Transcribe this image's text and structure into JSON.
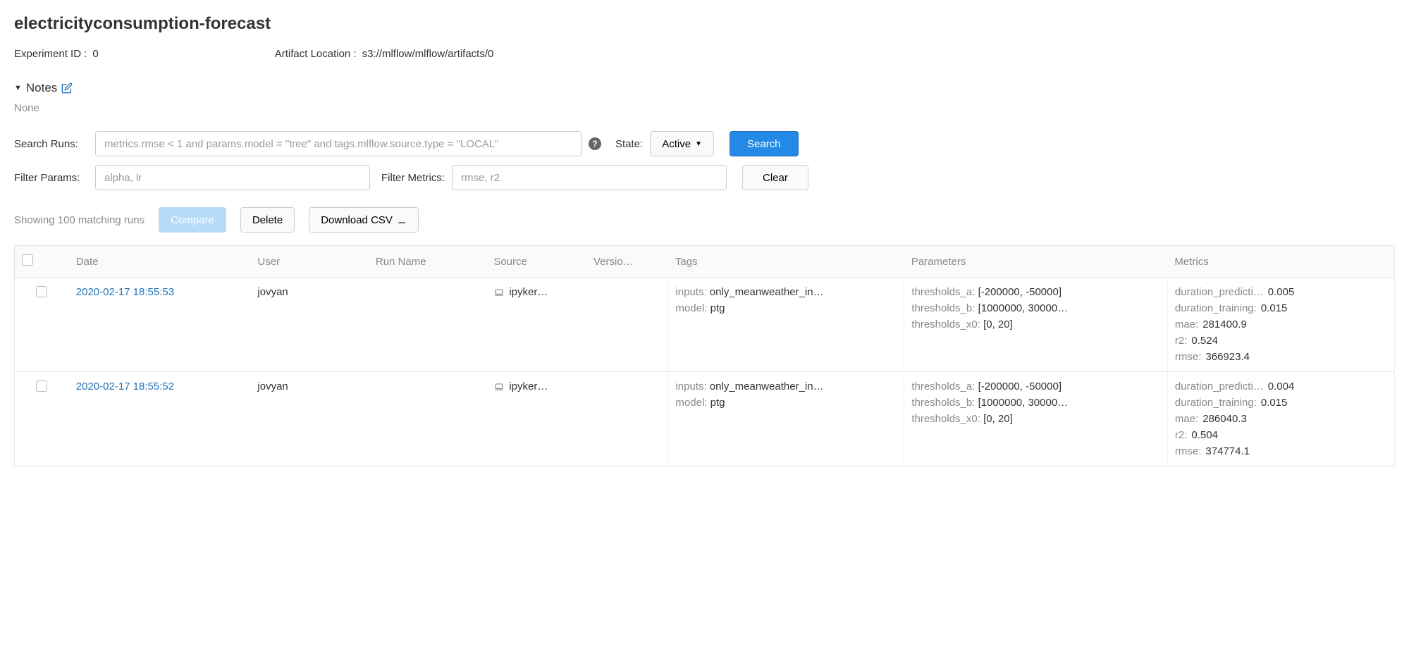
{
  "title": "electricityconsumption-forecast",
  "meta": {
    "experiment_id_label": "Experiment ID :",
    "experiment_id_value": "0",
    "artifact_location_label": "Artifact Location :",
    "artifact_location_value": "s3://mlflow/mlflow/artifacts/0"
  },
  "notes": {
    "header": "Notes",
    "body": "None"
  },
  "search": {
    "label": "Search Runs:",
    "placeholder": "metrics.rmse < 1 and params.model = \"tree\" and tags.mlflow.source.type = \"LOCAL\"",
    "state_label": "State:",
    "active_label": "Active",
    "search_button": "Search"
  },
  "filters": {
    "params_label": "Filter Params:",
    "params_placeholder": "alpha, lr",
    "metrics_label": "Filter Metrics:",
    "metrics_placeholder": "rmse, r2",
    "clear_button": "Clear"
  },
  "results": {
    "showing_text": "Showing 100 matching runs",
    "compare_button": "Compare",
    "delete_button": "Delete",
    "download_button": "Download CSV"
  },
  "table": {
    "headers": {
      "date": "Date",
      "user": "User",
      "run_name": "Run Name",
      "source": "Source",
      "version": "Versio…",
      "tags": "Tags",
      "parameters": "Parameters",
      "metrics": "Metrics"
    },
    "rows": [
      {
        "date": "2020-02-17 18:55:53",
        "user": "jovyan",
        "source": "ipyker…",
        "tags": [
          {
            "key": "inputs:",
            "val": "only_meanweather_in…"
          },
          {
            "key": "model:",
            "val": "ptg"
          }
        ],
        "params": [
          {
            "key": "thresholds_a:",
            "val": "[-200000, -50000]"
          },
          {
            "key": "thresholds_b:",
            "val": "[1000000, 30000…"
          },
          {
            "key": "thresholds_x0:",
            "val": "[0, 20]"
          }
        ],
        "metrics": [
          {
            "key": "duration_predicti…",
            "val": "0.005"
          },
          {
            "key": "duration_training:",
            "val": "0.015"
          },
          {
            "key": "mae:",
            "val": "281400.9"
          },
          {
            "key": "r2:",
            "val": "0.524"
          },
          {
            "key": "rmse:",
            "val": "366923.4"
          }
        ]
      },
      {
        "date": "2020-02-17 18:55:52",
        "user": "jovyan",
        "source": "ipyker…",
        "tags": [
          {
            "key": "inputs:",
            "val": "only_meanweather_in…"
          },
          {
            "key": "model:",
            "val": "ptg"
          }
        ],
        "params": [
          {
            "key": "thresholds_a:",
            "val": "[-200000, -50000]"
          },
          {
            "key": "thresholds_b:",
            "val": "[1000000, 30000…"
          },
          {
            "key": "thresholds_x0:",
            "val": "[0, 20]"
          }
        ],
        "metrics": [
          {
            "key": "duration_predicti…",
            "val": "0.004"
          },
          {
            "key": "duration_training:",
            "val": "0.015"
          },
          {
            "key": "mae:",
            "val": "286040.3"
          },
          {
            "key": "r2:",
            "val": "0.504"
          },
          {
            "key": "rmse:",
            "val": "374774.1"
          }
        ]
      }
    ]
  }
}
